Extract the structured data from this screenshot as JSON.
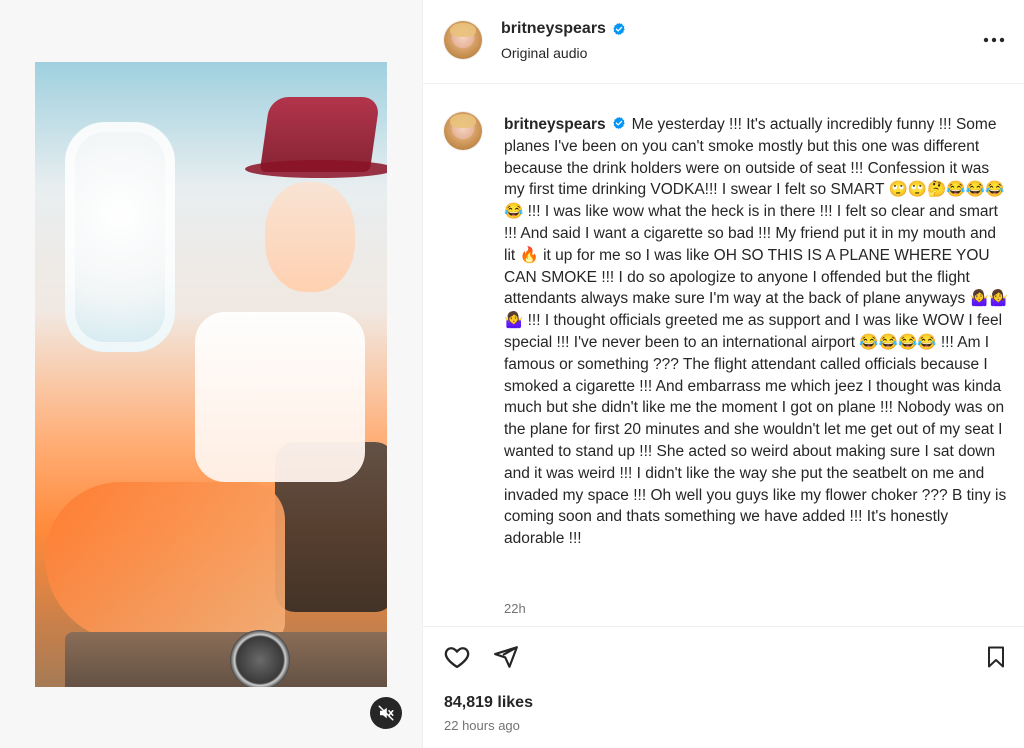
{
  "post": {
    "username": "britneyspears",
    "audio": "Original audio",
    "caption": "Me yesterday !!! It's actually incredibly funny !!! Some planes I've been on you can't smoke mostly but this one was different because the drink holders were on outside of seat !!! Confession it was my first time drinking VODKA!!! I swear I felt so SMART 🙄🙄🤔😂😂😂😂 !!! I was like wow what the heck is in there !!! I felt so clear and smart !!! And said I want a cigarette so bad !!! My friend put it in my mouth and lit 🔥 it up for me so I was like OH SO THIS IS A PLANE WHERE YOU CAN SMOKE !!! I do so apologize to anyone I offended but the flight attendants always make sure I'm way at the back of plane anyways 🤷‍♀️🤷‍♀️🤷‍♀️ !!! I thought officials greeted me as support and I was like WOW I feel special !!! I've never been to an international airport 😂😂😂😂 !!! Am I famous or something ??? The flight attendant called officials because I smoked a cigarette !!! And embarrass me which jeez I thought was kinda much but she didn't like me the moment I got on plane !!! Nobody was on the plane for first 20 minutes and she wouldn't let me get out of my seat I wanted to stand up !!! She acted so weird about making sure I sat down and it was weird !!! I didn't like the way she put the seatbelt on me and invaded my space !!! Oh well you guys like my flower choker ??? B tiny is coming soon and thats something we have added !!! It's honestly adorable !!!",
    "caption_time": "22h",
    "likes": "84,819 likes",
    "time_ago": "22 hours ago"
  },
  "icons": {
    "verified": "verified-badge-icon",
    "more": "more-options-icon",
    "like": "heart-icon",
    "share": "paper-plane-icon",
    "save": "bookmark-icon",
    "mute": "speaker-muted-icon"
  },
  "colors": {
    "verified": "#0095f6",
    "text": "#262626",
    "secondary_text": "#737373",
    "border": "#efefef"
  }
}
